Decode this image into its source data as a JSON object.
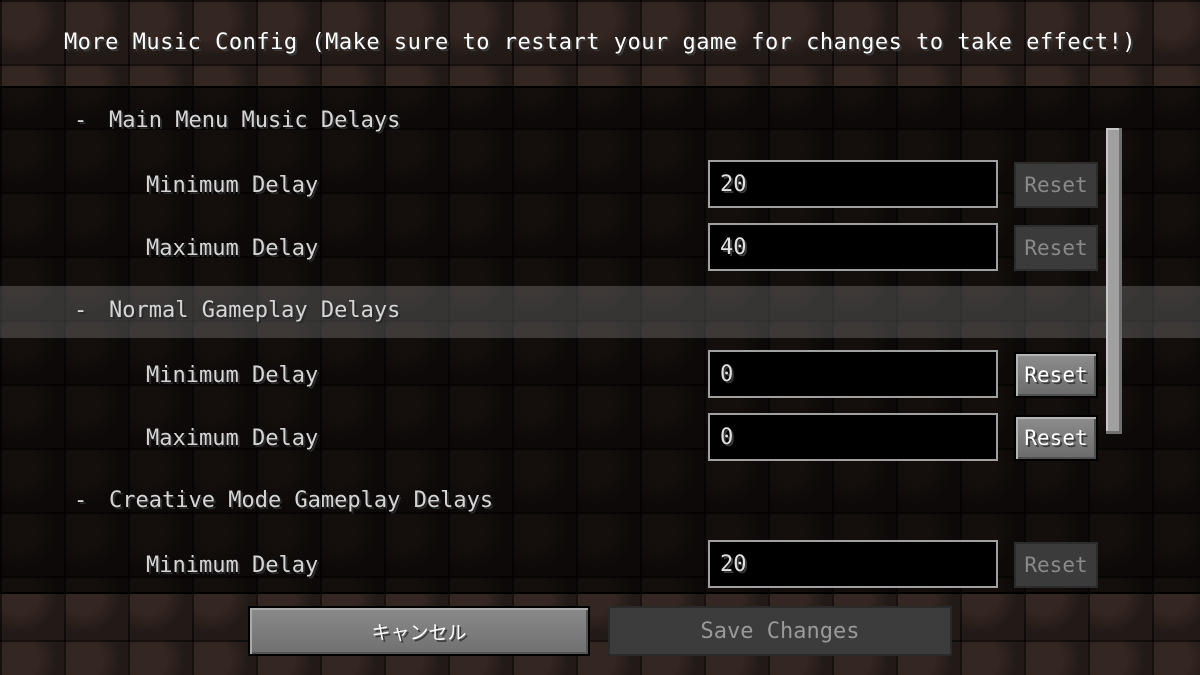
{
  "title": "More Music Config (Make sure to restart your game for changes to take effect!)",
  "sections": [
    {
      "label": "Main Menu Music Delays",
      "dash": "-",
      "fields": [
        {
          "label": "Minimum Delay",
          "value": "20",
          "reset_label": "Reset",
          "reset_enabled": false
        },
        {
          "label": "Maximum Delay",
          "value": "40",
          "reset_label": "Reset",
          "reset_enabled": false
        }
      ]
    },
    {
      "label": "Normal Gameplay Delays",
      "dash": "-",
      "fields": [
        {
          "label": "Minimum Delay",
          "value": "0",
          "reset_label": "Reset",
          "reset_enabled": true
        },
        {
          "label": "Maximum Delay",
          "value": "0",
          "reset_label": "Reset",
          "reset_enabled": true
        }
      ]
    },
    {
      "label": "Creative Mode Gameplay Delays",
      "dash": "-",
      "fields": [
        {
          "label": "Minimum Delay",
          "value": "20",
          "reset_label": "Reset",
          "reset_enabled": false
        }
      ]
    }
  ],
  "buttons": {
    "cancel_label": "キャンセル",
    "save_label": "Save Changes"
  },
  "colors": {
    "text_primary": "#ffffff",
    "text_label": "#d6d6d6",
    "button_disabled": "#3b3b3b",
    "button_enabled": "#7c7c7c"
  }
}
